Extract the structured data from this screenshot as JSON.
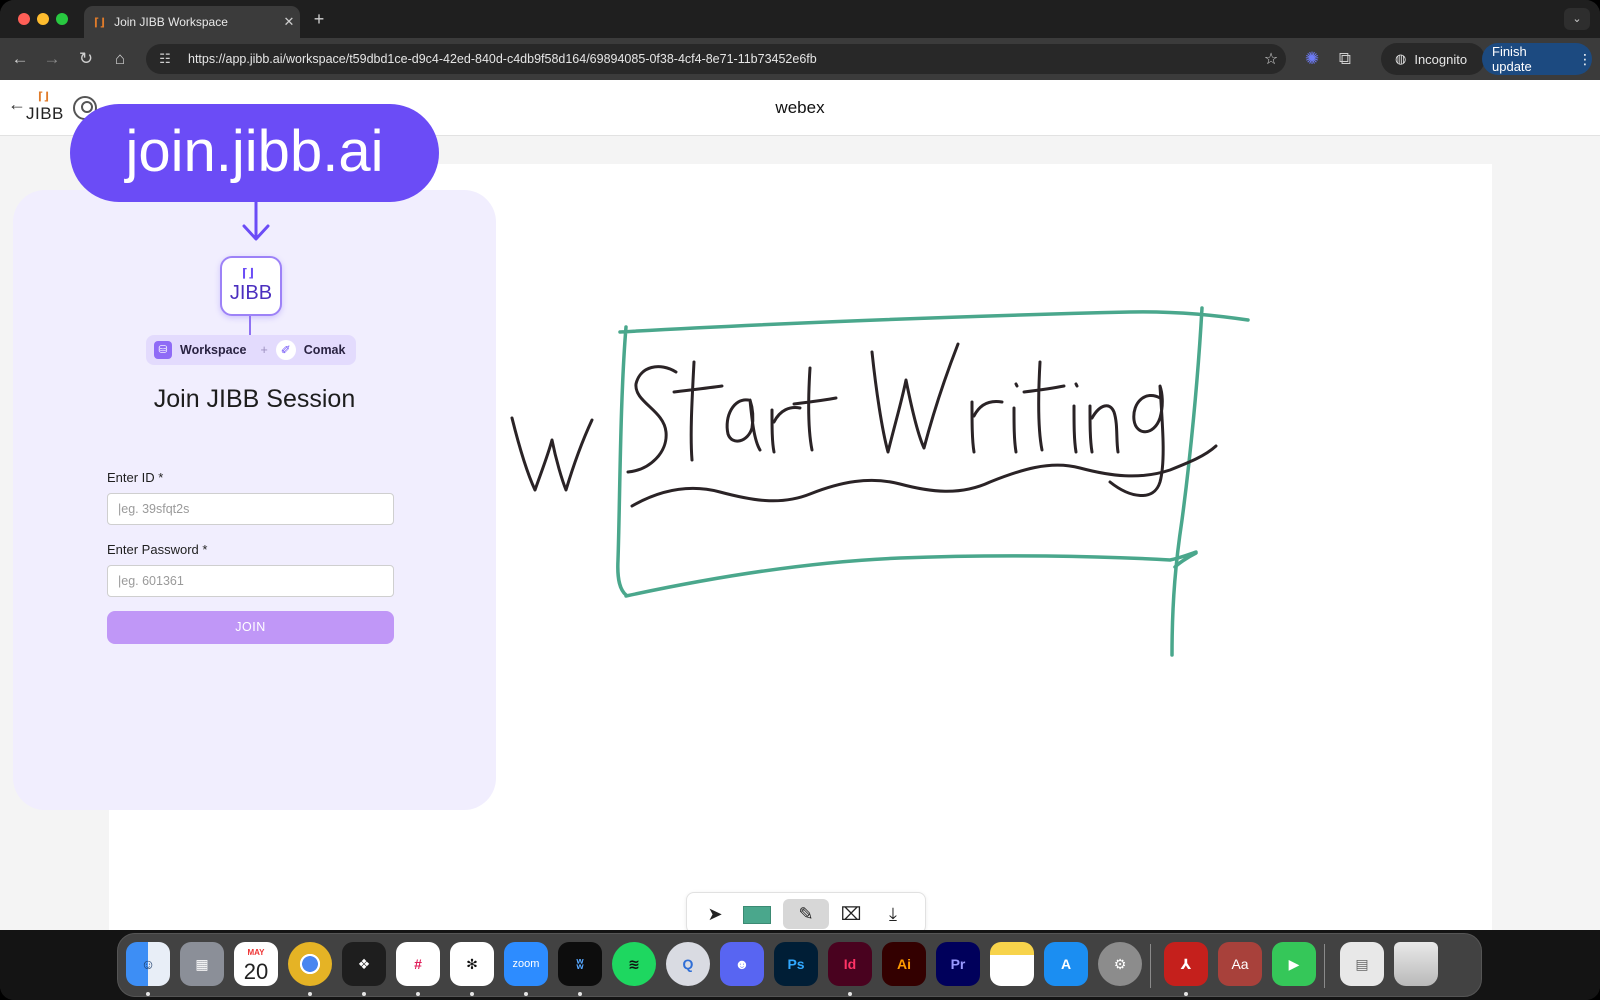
{
  "browser": {
    "tab_title": "Join JIBB Workspace",
    "tab_favicon": "⌈⌋",
    "url": "https://app.jibb.ai/workspace/t59dbd1ce-d9c4-42ed-840d-c4db9f58d164/69894085-0f38-4cf4-8e71-11b73452e6fb",
    "incognito_label": "Incognito",
    "update_label": "Finish update"
  },
  "app": {
    "logo_word": "JIBB",
    "logo_mark": "⌈⌋",
    "title": "webex"
  },
  "overlay": {
    "join_url": "join.jibb.ai",
    "logo_word": "JIBB",
    "logo_mark": "⌈⌋",
    "pill_workspace": "Workspace",
    "pill_plus": "+",
    "pill_comak": "Comak",
    "form_title": "Join JIBB Session",
    "id_label": "Enter ID *",
    "id_placeholder": "|eg. 39sfqt2s",
    "password_label": "Enter Password *",
    "password_placeholder": "|eg. 601361",
    "join_label": "JOIN",
    "accent_color": "#6b4cf6"
  },
  "canvas": {
    "handwriting": "Start Writing",
    "stray_letter": "W",
    "frame_color": "#4aa78c",
    "ink_color": "#2a2326"
  },
  "drawbar": {
    "tools": [
      "cursor-icon",
      "color-swatch",
      "pen-icon",
      "delete-icon",
      "download-icon"
    ],
    "active": "pen-icon"
  },
  "dock": {
    "calendar_month": "MAY",
    "calendar_day": "20",
    "zoom_label": "zoom",
    "ps_label": "Ps",
    "id_label": "Id",
    "ai_label": "Ai",
    "pr_label": "Pr",
    "dict_label": "Aa"
  }
}
